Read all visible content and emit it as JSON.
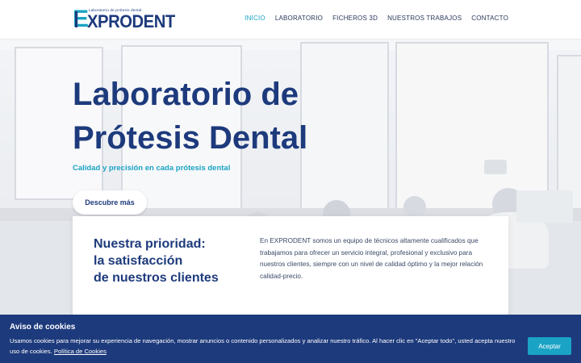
{
  "header": {
    "logo_letter": "E",
    "logo_sub": "Laboratorio de prótesis dental",
    "logo_main": "XPRODENT",
    "nav": [
      {
        "label": "INICIO",
        "active": true
      },
      {
        "label": "LABORATORIO",
        "active": false
      },
      {
        "label": "FICHEROS 3D",
        "active": false
      },
      {
        "label": "NUESTROS TRABAJOS",
        "active": false
      },
      {
        "label": "CONTACTO",
        "active": false
      }
    ]
  },
  "hero": {
    "title_line1": "Laboratorio de",
    "title_line2": "Prótesis Dental",
    "subtitle": "Calidad y precisión en cada prótesis dental",
    "button": "Descubre más"
  },
  "card": {
    "heading_line1": "Nuestra prioridad:",
    "heading_line2": "la satisfacción",
    "heading_line3": "de nuestros clientes",
    "text": "En EXPRODENT somos un equipo de técnicos altamente cualificados que trabajamos para ofrecer un servicio integral, profesional y exclusivo para nuestros clientes, siempre con un nivel de calidad óptimo y la mejor relación calidad-precio."
  },
  "cookie": {
    "title": "Aviso de cookies",
    "text": "Usamos cookies para mejorar su experiencia de navegación, mostrar anuncios o contenido personalizados y analizar nuestro tráfico. Al hacer clic en \"Aceptar todo\", usted acepta nuestro uso de cookies.",
    "link": "Política de Cookies",
    "button": "Aceptar"
  },
  "colors": {
    "brand_navy": "#1d3a7c",
    "brand_cyan": "#1aa3c4"
  }
}
